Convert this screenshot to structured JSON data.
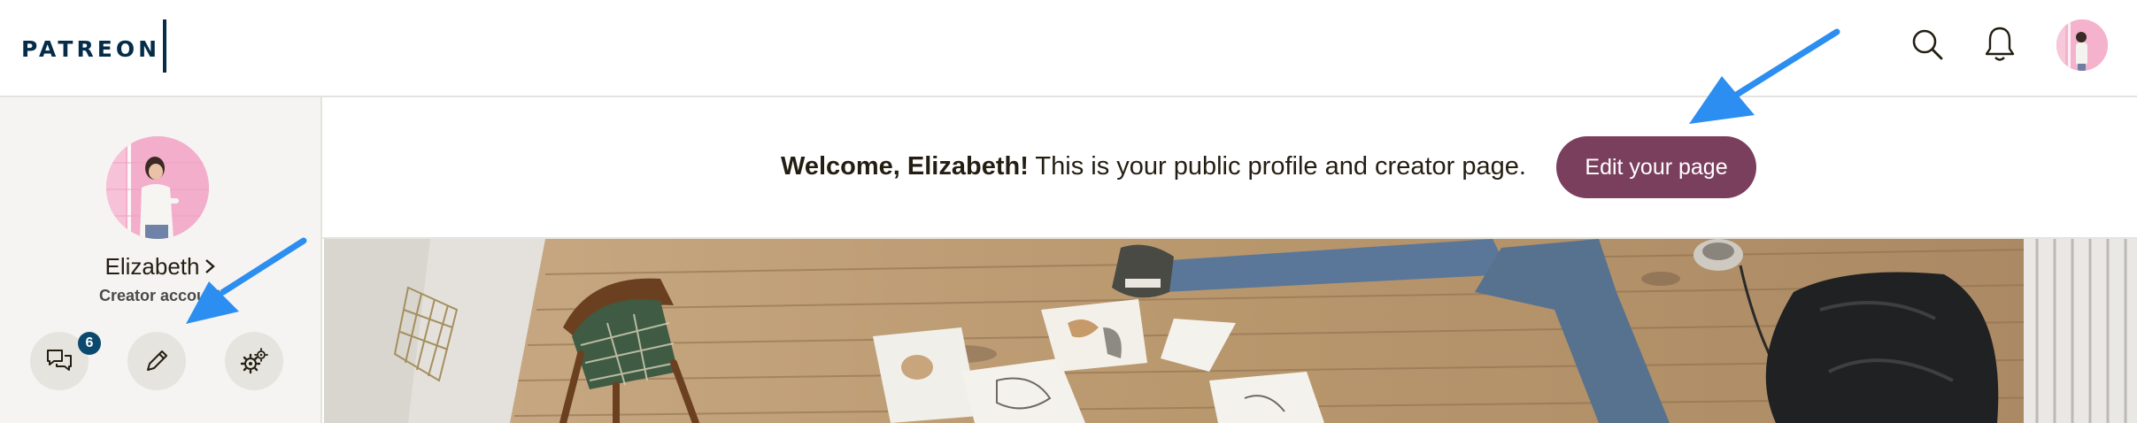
{
  "header": {
    "logo_text": "PATREON",
    "icons": [
      "search-icon",
      "bell-icon",
      "user-avatar"
    ]
  },
  "sidebar": {
    "profile_name": "Elizabeth",
    "account_type": "Creator account",
    "messages_badge": "6",
    "actions": [
      "messages-icon",
      "edit-icon",
      "settings-icon"
    ]
  },
  "welcome": {
    "greeting": "Welcome, Elizabeth!",
    "message": " This is your public profile and creator page.",
    "edit_button_label": "Edit your page"
  },
  "colors": {
    "brand_navy": "#052d49",
    "edit_button": "#7b3f5e",
    "annotation_arrow": "#2b8ef0",
    "badge": "#0b4a6e"
  }
}
